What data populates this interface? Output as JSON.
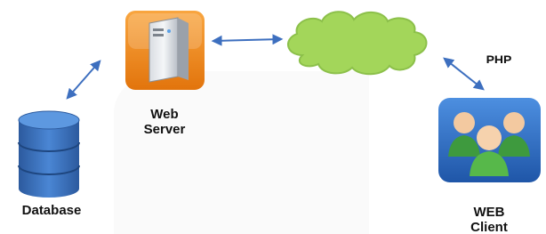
{
  "nodes": {
    "web_server": {
      "label_line1": "Web",
      "label_line2": "Server"
    },
    "database": {
      "label": "Database"
    },
    "internet": {
      "label": "PHP"
    },
    "web_client": {
      "label_line1": "WEB",
      "label_line2": "Client"
    }
  },
  "colors": {
    "arrow": "#3d6fbf",
    "cloud_fill": "#a3d65a",
    "cloud_stroke": "#8cc04a",
    "server_bg": "#f08a1c",
    "database_fill": "#3a6fb6",
    "client_bg": "#2f6bc4",
    "backdrop": "#fafafa"
  }
}
